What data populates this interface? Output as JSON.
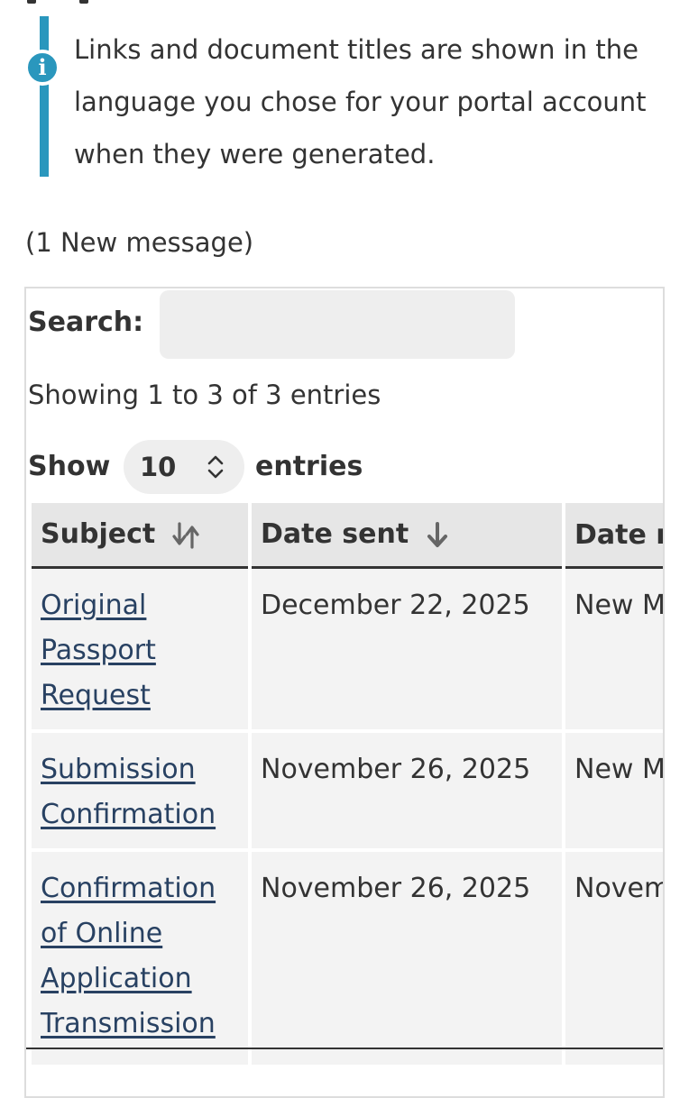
{
  "notice": {
    "icon": "info-icon",
    "icon_glyph": "i",
    "text": "Links and document titles are shown in the language you chose for your portal account when they were generated."
  },
  "new_messages": "(1 New message)",
  "search": {
    "label": "Search:",
    "value": "",
    "placeholder": ""
  },
  "table_info": "Showing 1 to 3 of 3 entries",
  "length_menu": {
    "prefix": "Show",
    "selected": "10",
    "suffix": "entries"
  },
  "table": {
    "columns": [
      {
        "label": "Subject",
        "sort_icon": "sort-both-icon"
      },
      {
        "label": "Date sent",
        "sort_icon": "sort-desc-icon"
      },
      {
        "label": "Date r"
      }
    ],
    "rows": [
      {
        "subject": "Original Passport Request",
        "date_sent": "December 22, 2025",
        "date_read": "New M"
      },
      {
        "subject": "Submission Confirmation",
        "date_sent": "November 26, 2025",
        "date_read": "New M"
      },
      {
        "subject": "Confirmation of Online Application Transmission",
        "date_sent": "November 26, 2025",
        "date_read": "Novem"
      }
    ]
  },
  "colors": {
    "accent": "#2a97bd",
    "link": "#284162",
    "text": "#333333",
    "header_bg": "#e6e6e6",
    "cell_bg": "#f3f3f3"
  }
}
